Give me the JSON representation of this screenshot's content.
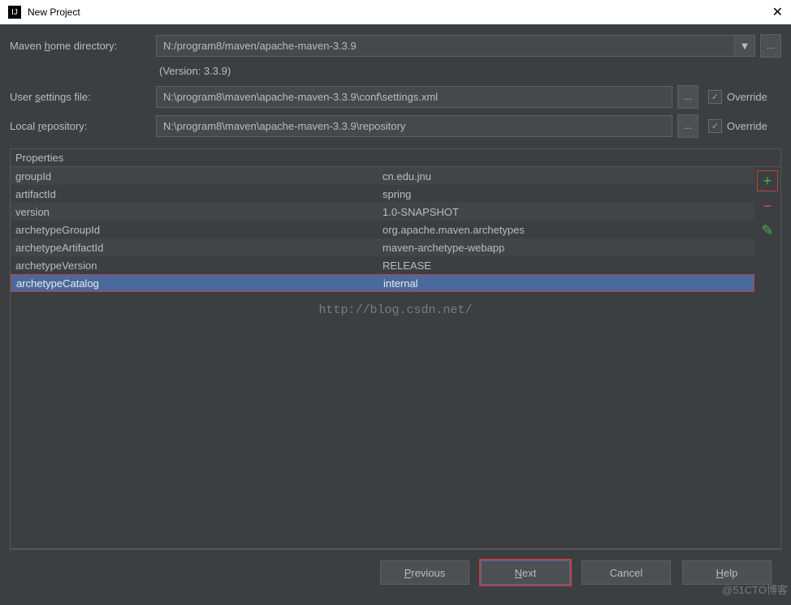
{
  "titlebar": {
    "title": "New Project"
  },
  "form": {
    "mavenHome": {
      "label_pre": "Maven ",
      "label_u": "h",
      "label_post": "ome directory:",
      "value": "N:/program8/maven/apache-maven-3.3.9",
      "versionNote": "(Version: 3.3.9)"
    },
    "userSettings": {
      "label_pre": "User ",
      "label_u": "s",
      "label_post": "ettings file:",
      "value": "N:\\program8\\maven\\apache-maven-3.3.9\\conf\\settings.xml",
      "override": "Override"
    },
    "localRepo": {
      "label_pre": "Local ",
      "label_u": "r",
      "label_post": "epository:",
      "value": "N:\\program8\\maven\\apache-maven-3.3.9\\repository",
      "override": "Override"
    }
  },
  "properties": {
    "header": "Properties",
    "rows": [
      {
        "k": "groupId",
        "v": "cn.edu.jnu"
      },
      {
        "k": "artifactId",
        "v": "spring"
      },
      {
        "k": "version",
        "v": "1.0-SNAPSHOT"
      },
      {
        "k": "archetypeGroupId",
        "v": "org.apache.maven.archetypes"
      },
      {
        "k": "archetypeArtifactId",
        "v": "maven-archetype-webapp"
      },
      {
        "k": "archetypeVersion",
        "v": "RELEASE"
      },
      {
        "k": "archetypeCatalog",
        "v": "internal"
      }
    ]
  },
  "watermark": "http://blog.csdn.net/",
  "footer": {
    "previous_u": "P",
    "previous_r": "revious",
    "next_u": "N",
    "next_r": "ext",
    "cancel": "Cancel",
    "help_u": "H",
    "help_r": "elp"
  },
  "corner": "@51CTO博客"
}
